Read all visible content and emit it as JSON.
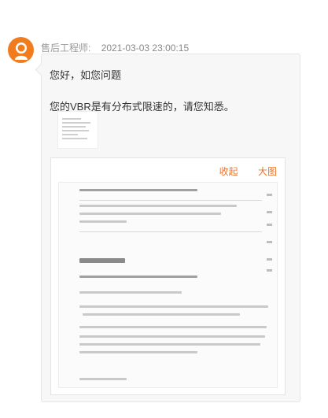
{
  "sender": {
    "name": "售后工程师:",
    "timestamp": "2021-03-03 23:00:15"
  },
  "message": {
    "greeting": "您好，如您问题",
    "body": "您的VBR是有分布式限速的，请您知悉。"
  },
  "image_viewer": {
    "collapse_label": "收起",
    "enlarge_label": "大图"
  },
  "colors": {
    "accent": "#e8742b",
    "avatar_bg": "#f07c1e",
    "bubble_bg": "#f7f7f7"
  }
}
